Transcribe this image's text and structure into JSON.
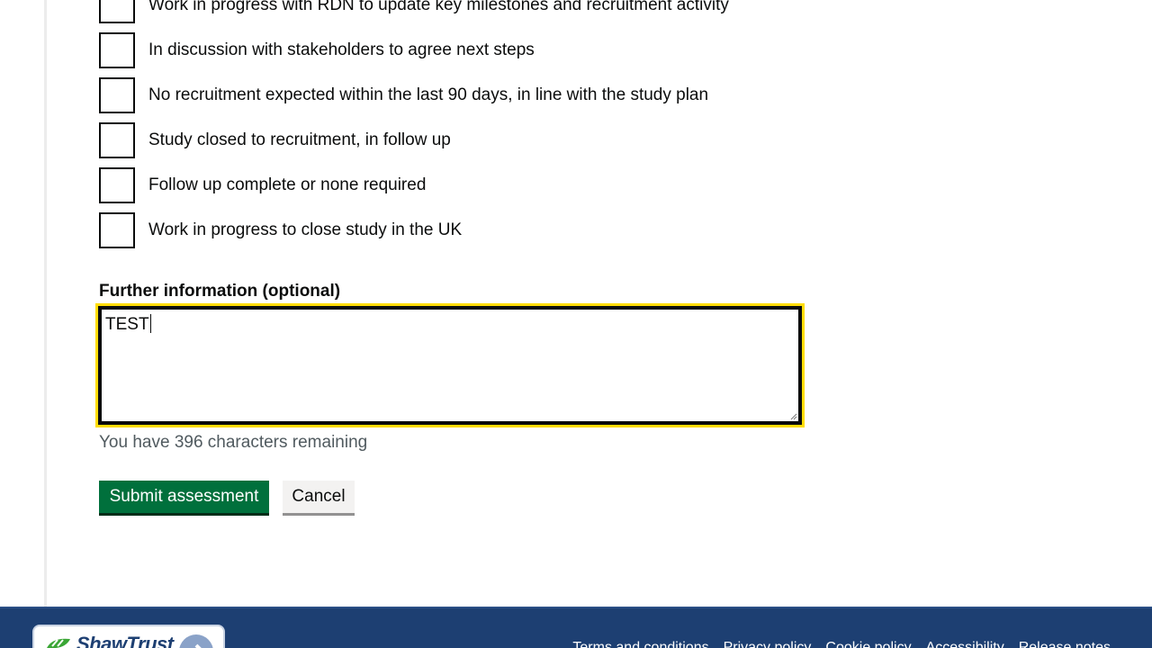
{
  "status_options": [
    {
      "label": "Work in progress with RDN to update key milestones and recruitment activity",
      "checked": false
    },
    {
      "label": "In discussion with stakeholders to agree next steps",
      "checked": false
    },
    {
      "label": "No recruitment expected within the last 90 days, in line with the study plan",
      "checked": false
    },
    {
      "label": "Study closed to recruitment, in follow up",
      "checked": false
    },
    {
      "label": "Follow up complete or none required",
      "checked": false
    },
    {
      "label": "Work in progress to close study in the UK",
      "checked": false
    }
  ],
  "further_info": {
    "label": "Further information (optional)",
    "value": "TEST",
    "hint": "You have 396 characters remaining"
  },
  "actions": {
    "submit_label": "Submit assessment",
    "cancel_label": "Cancel"
  },
  "footer": {
    "logo_text": "ShawTrust",
    "links": [
      "Terms and conditions",
      "Privacy policy",
      "Cookie policy",
      "Accessibility",
      "Release notes"
    ]
  },
  "colors": {
    "primary_button": "#00703c",
    "focus": "#ffdd00",
    "footer_bg": "#1d3f72",
    "hint_text": "#505a5f"
  }
}
